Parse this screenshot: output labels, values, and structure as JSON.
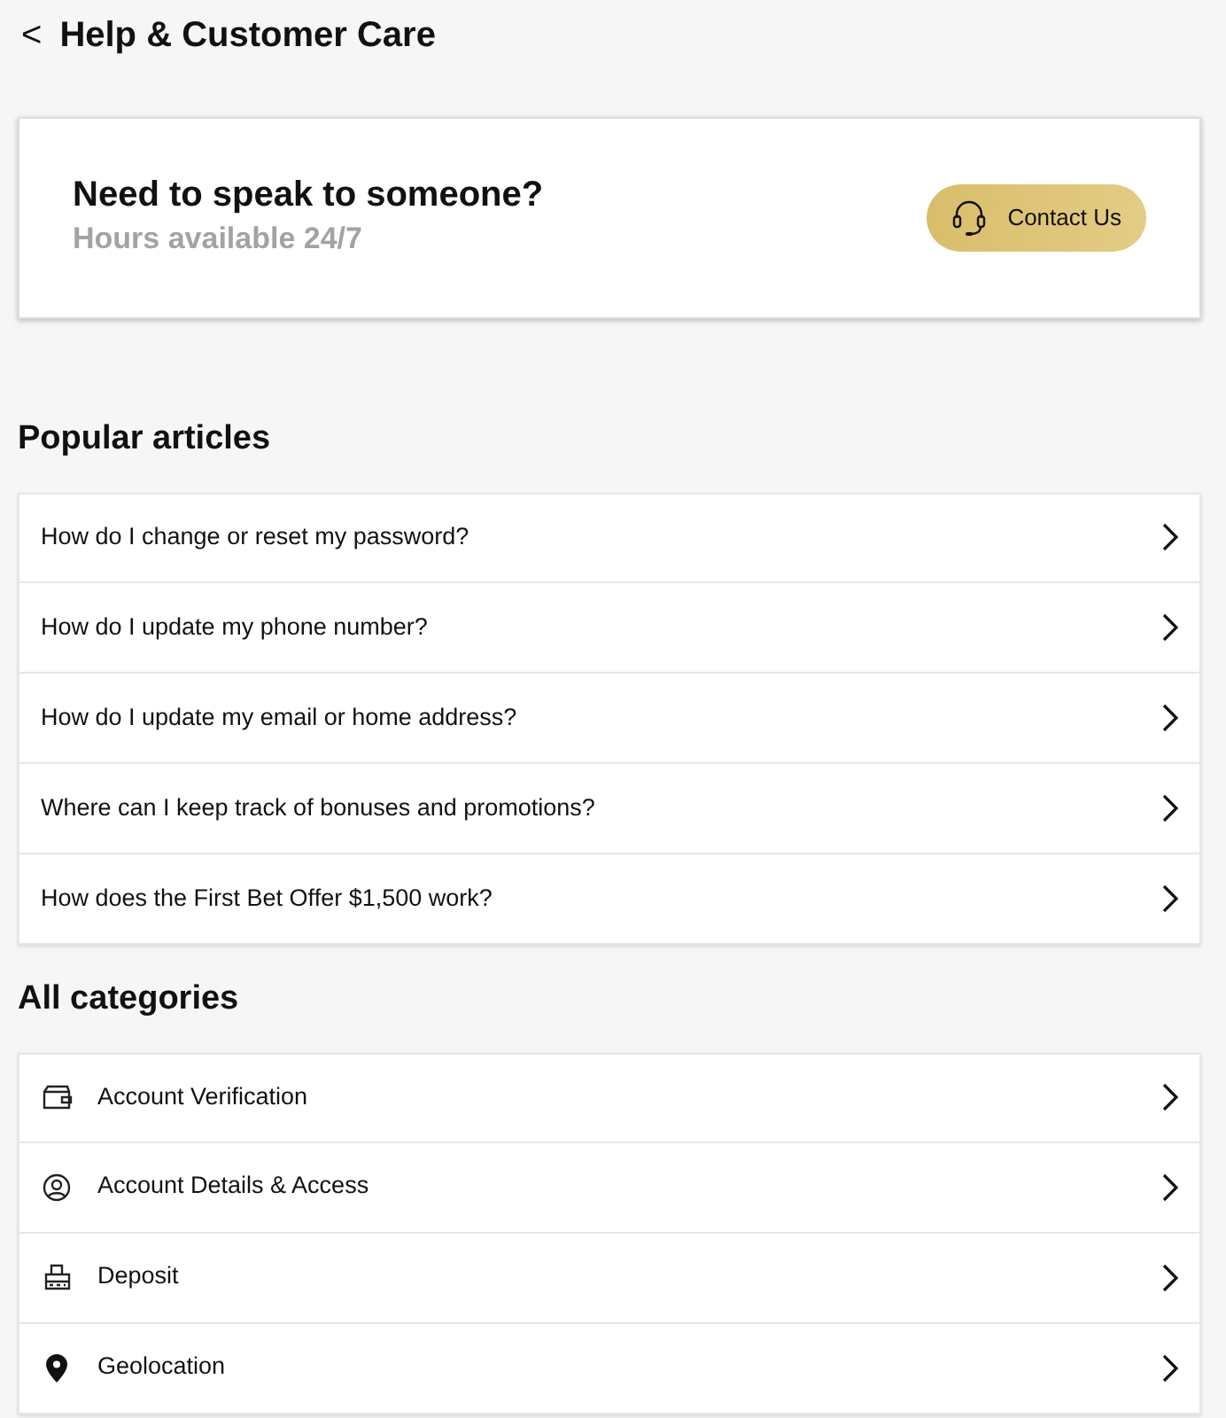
{
  "header": {
    "back": "<",
    "title": "Help & Customer Care"
  },
  "contact_card": {
    "heading": "Need to speak to someone?",
    "subheading": "Hours available 24/7",
    "button": "Contact Us"
  },
  "popular_articles": {
    "title": "Popular articles",
    "items": [
      {
        "label": "How do I change or reset my password?"
      },
      {
        "label": "How do I update my phone number?"
      },
      {
        "label": "How do I update my email or home address?"
      },
      {
        "label": "Where can I keep track of bonuses and promotions?"
      },
      {
        "label": "How does the First Bet Offer $1,500 work?"
      }
    ]
  },
  "all_categories": {
    "title": "All categories",
    "items": [
      {
        "label": "Account Verification",
        "kind": "wallet"
      },
      {
        "label": "Account Details & Access",
        "kind": "user"
      },
      {
        "label": "Deposit",
        "kind": "register"
      },
      {
        "label": "Geolocation",
        "kind": "pin"
      }
    ]
  }
}
